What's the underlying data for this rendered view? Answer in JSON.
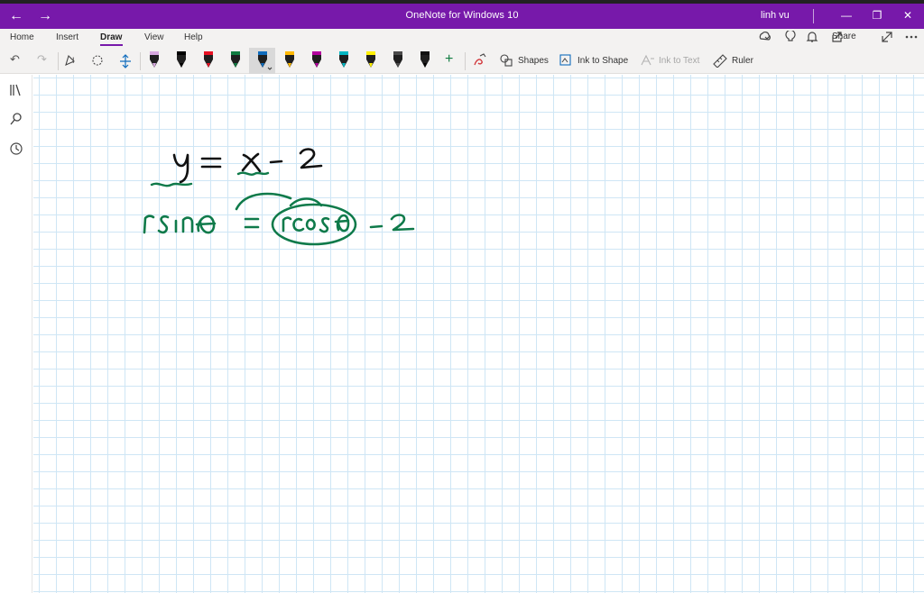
{
  "window": {
    "title": "OneNote for Windows 10",
    "user": "linh vu",
    "back_glyph": "←",
    "forward_glyph": "→",
    "minimize_glyph": "—",
    "maximize_glyph": "❐",
    "close_glyph": "✕"
  },
  "tabs": [
    {
      "label": "Home"
    },
    {
      "label": "Insert"
    },
    {
      "label": "Draw",
      "active": true
    },
    {
      "label": "View"
    },
    {
      "label": "Help"
    }
  ],
  "ribbon_right": {
    "share_label": "Share",
    "icons": [
      "sync-status-icon",
      "lightbulb-icon",
      "bell-icon",
      "share-icon",
      "expand-icon",
      "more-icon"
    ]
  },
  "toolbar": {
    "undo_glyph": "↶",
    "redo_glyph": "↷",
    "add_pen_glyph": "+",
    "shapes_label": "Shapes",
    "ink_to_shape_label": "Ink to Shape",
    "ink_to_text_label": "Ink to Text",
    "ruler_label": "Ruler",
    "pens": [
      {
        "color": "#d7a8e0"
      },
      {
        "color": "#000000"
      },
      {
        "color": "#e81123"
      },
      {
        "color": "#107c41"
      },
      {
        "color": "#0f6cbd"
      },
      {
        "color": "#ffb900"
      },
      {
        "color": "#b4009e"
      },
      {
        "color": "#00b7c3"
      },
      {
        "color": "#fff100"
      },
      {
        "color": "#4a4a4a"
      },
      {
        "color": "#111111"
      }
    ]
  },
  "colors": {
    "accent": "#7719aa",
    "ink_black": "#111111",
    "ink_green": "#0f7a4a",
    "grid": "#cfe6f5"
  }
}
